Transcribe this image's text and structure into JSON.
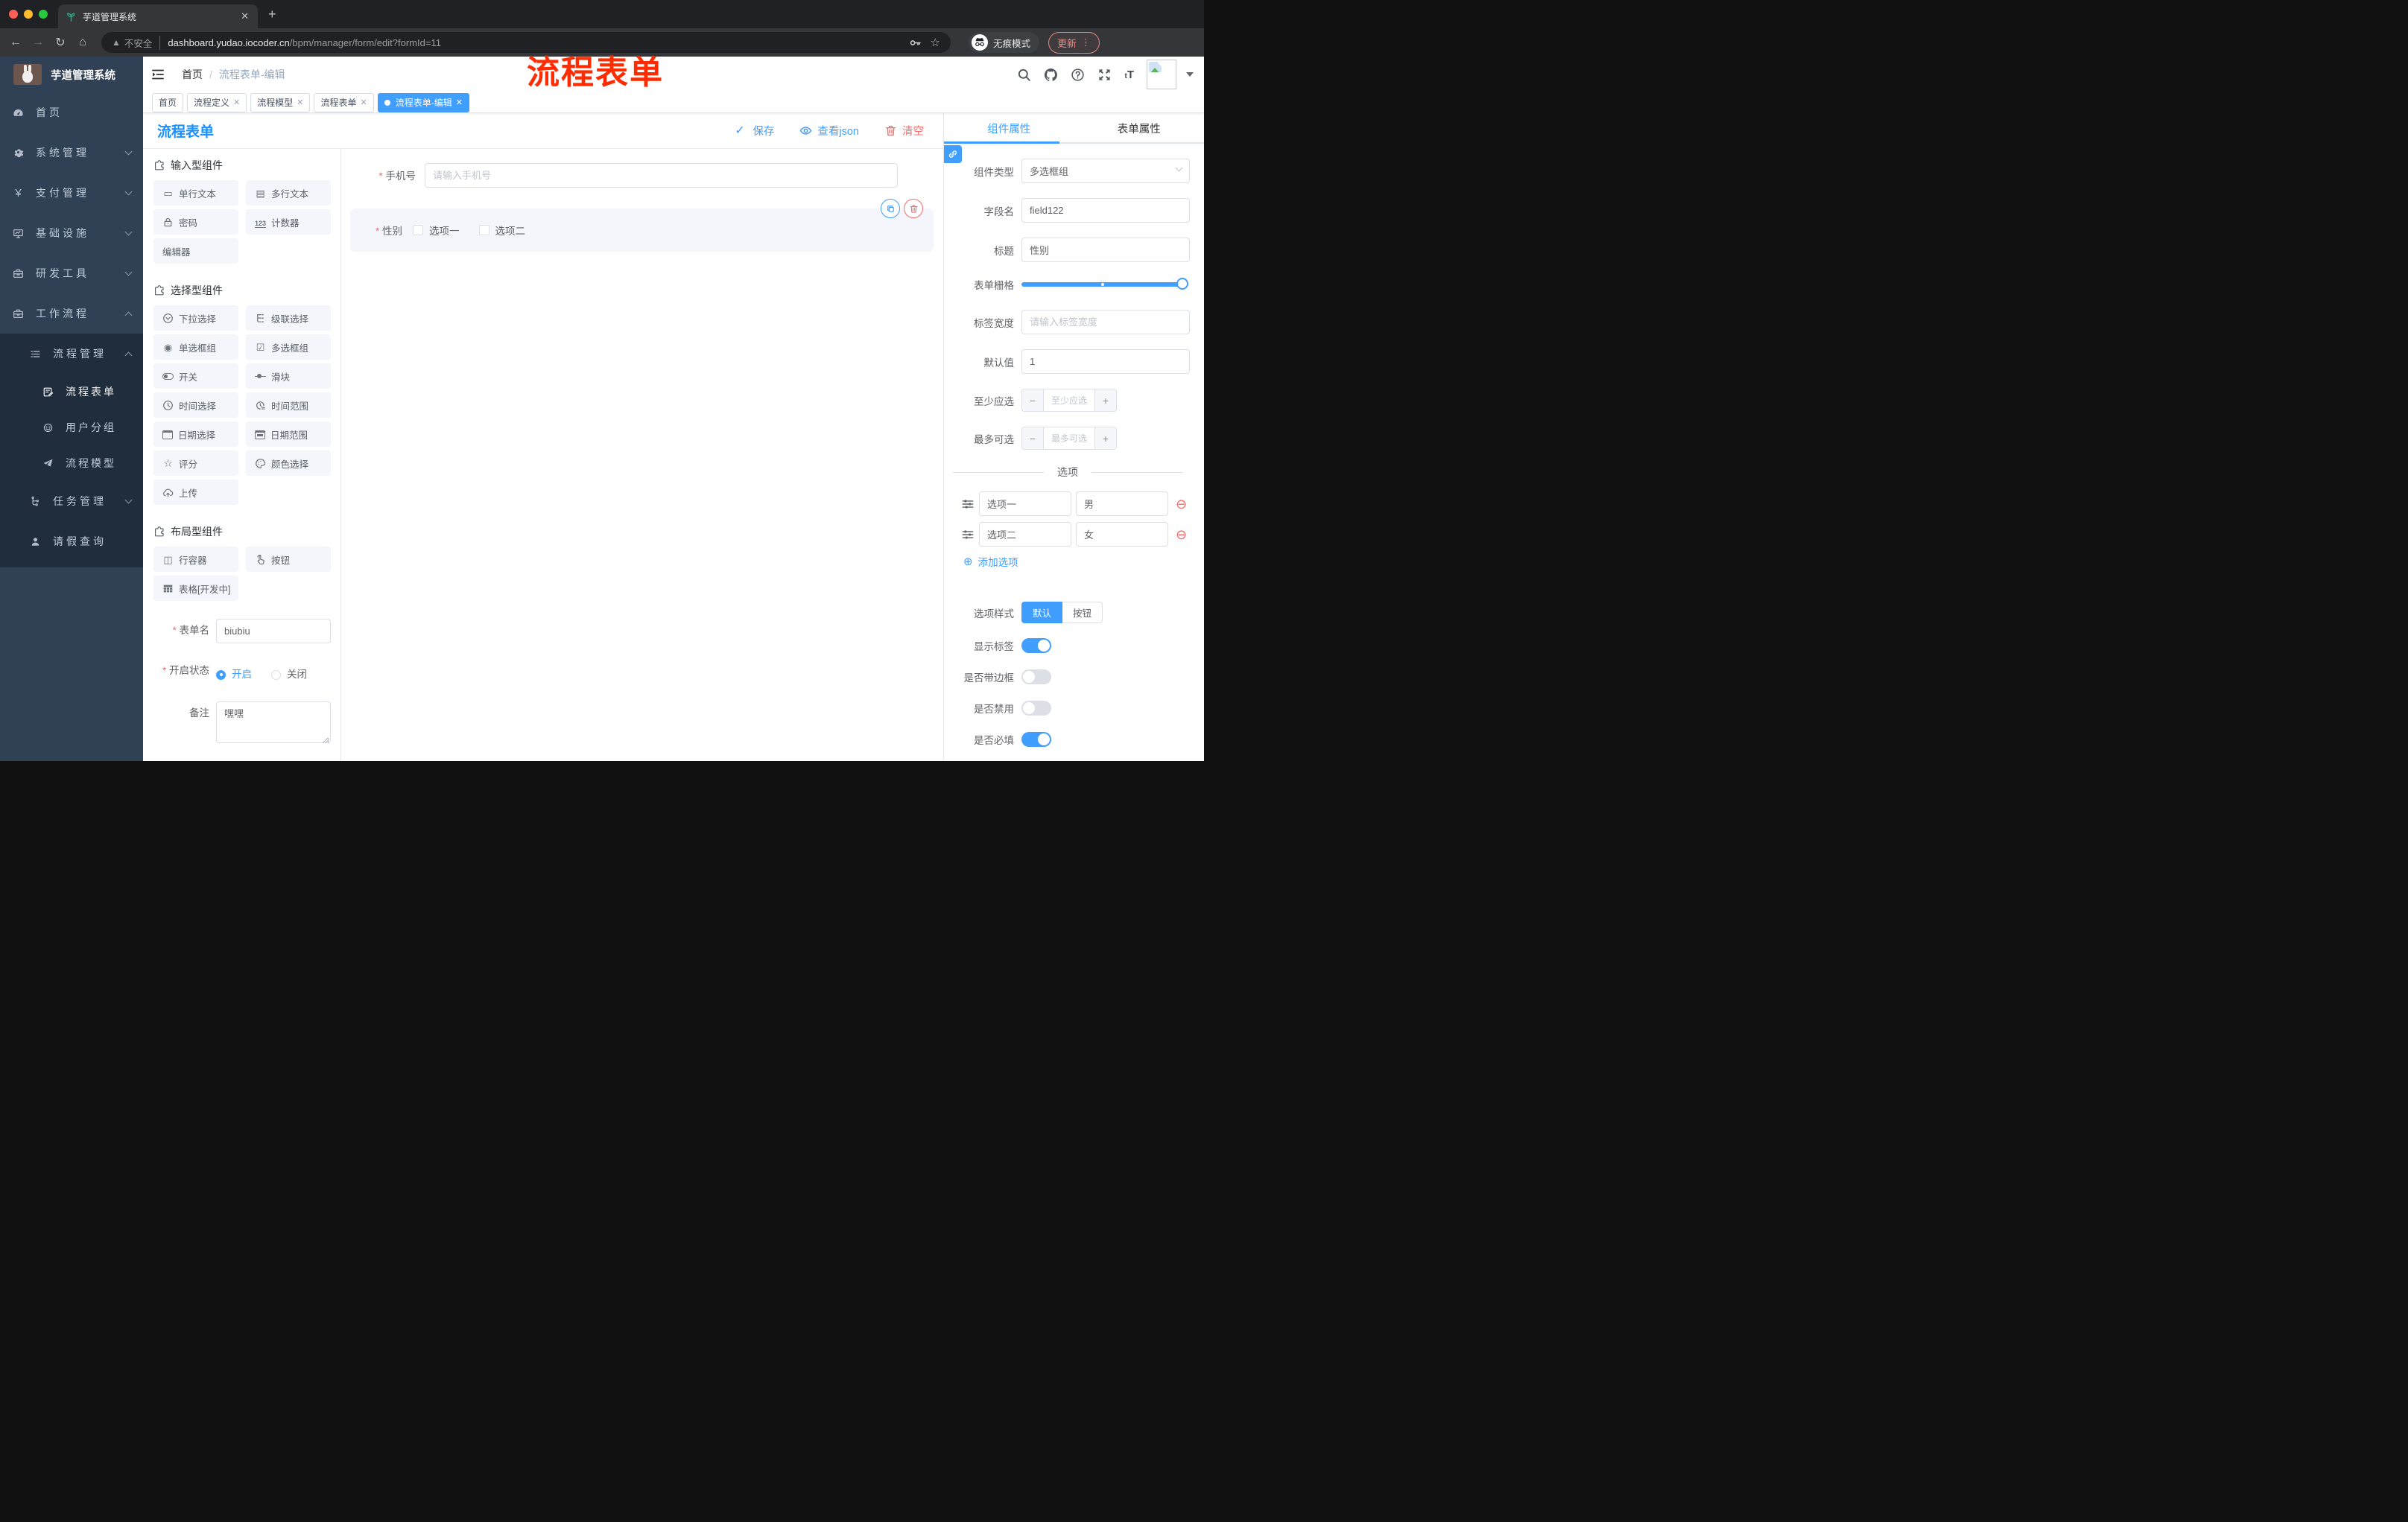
{
  "browser": {
    "tab_title": "芋道管理系统",
    "security_label": "不安全",
    "url_domain": "dashboard.yudao.iocoder.cn",
    "url_path": "/bpm/manager/form/edit?formId=11",
    "incognito_label": "无痕模式",
    "update_label": "更新"
  },
  "annotation": {
    "text": "流程表单",
    "color": "#fe2c00"
  },
  "sidebar": {
    "title": "芋道管理系统",
    "menu": [
      {
        "label": "首页"
      },
      {
        "label": "系统管理"
      },
      {
        "label": "支付管理"
      },
      {
        "label": "基础设施"
      },
      {
        "label": "研发工具"
      },
      {
        "label": "工作流程"
      }
    ],
    "submenu": [
      {
        "label": "流程管理"
      },
      {
        "label": "流程表单"
      },
      {
        "label": "用户分组"
      },
      {
        "label": "流程模型"
      },
      {
        "label": "任务管理"
      },
      {
        "label": "请假查询"
      }
    ]
  },
  "header": {
    "breadcrumb_home": "首页",
    "breadcrumb_current": "流程表单-编辑"
  },
  "tags": [
    {
      "label": "首页"
    },
    {
      "label": "流程定义"
    },
    {
      "label": "流程模型"
    },
    {
      "label": "流程表单"
    },
    {
      "label": "流程表单-编辑"
    }
  ],
  "designer": {
    "title": "流程表单",
    "actions": {
      "save": "保存",
      "view_json": "查看json",
      "clear": "清空"
    },
    "palette": {
      "sections": [
        {
          "title": "输入型组件",
          "items": [
            {
              "label": "单行文本"
            },
            {
              "label": "多行文本"
            },
            {
              "label": "密码"
            },
            {
              "label": "计数器"
            },
            {
              "label": "编辑器"
            }
          ]
        },
        {
          "title": "选择型组件",
          "items": [
            {
              "label": "下拉选择"
            },
            {
              "label": "级联选择"
            },
            {
              "label": "单选框组"
            },
            {
              "label": "多选框组"
            },
            {
              "label": "开关"
            },
            {
              "label": "滑块"
            },
            {
              "label": "时间选择"
            },
            {
              "label": "时间范围"
            },
            {
              "label": "日期选择"
            },
            {
              "label": "日期范围"
            },
            {
              "label": "评分"
            },
            {
              "label": "颜色选择"
            },
            {
              "label": "上传"
            }
          ]
        },
        {
          "title": "布局型组件",
          "items": [
            {
              "label": "行容器"
            },
            {
              "label": "按钮"
            },
            {
              "label": "表格[开发中]"
            }
          ]
        }
      ]
    },
    "meta": {
      "name_label": "表单名",
      "name_value": "biubiu",
      "status_label": "开启状态",
      "status_on": "开启",
      "status_off": "关闭",
      "remark_label": "备注",
      "remark_value": "嘿嘿"
    },
    "canvas": {
      "phone_label": "手机号",
      "phone_placeholder": "请输入手机号",
      "gender_label": "性别",
      "gender_option1": "选项一",
      "gender_option2": "选项二"
    },
    "props": {
      "tab_component": "组件属性",
      "tab_form": "表单属性",
      "type_label": "组件类型",
      "type_value": "多选框组",
      "field_label": "字段名",
      "field_value": "field122",
      "title_label": "标题",
      "title_value": "性别",
      "grid_label": "表单栅格",
      "label_width_label": "标签宽度",
      "label_width_placeholder": "请输入标签宽度",
      "default_label": "默认值",
      "default_value": "1",
      "min_label": "至少应选",
      "min_placeholder": "至少应选",
      "max_label": "最多可选",
      "max_placeholder": "最多可选",
      "options_title": "选项",
      "options": [
        {
          "name": "选项一",
          "value": "男"
        },
        {
          "name": "选项二",
          "value": "女"
        }
      ],
      "add_option": "添加选项",
      "style_label": "选项样式",
      "style_default": "默认",
      "style_button": "按钮",
      "toggles": [
        {
          "label": "显示标签",
          "on": true
        },
        {
          "label": "是否带边框",
          "on": false
        },
        {
          "label": "是否禁用",
          "on": false
        },
        {
          "label": "是否必填",
          "on": true
        }
      ]
    }
  },
  "colors": {
    "accent": "#409eff",
    "danger": "#f56c6c",
    "title_blue": "#1890ff",
    "annotation_red": "#fe2c00",
    "sidebar_bg": "#304156",
    "submenu_bg": "#1f2d3d"
  }
}
